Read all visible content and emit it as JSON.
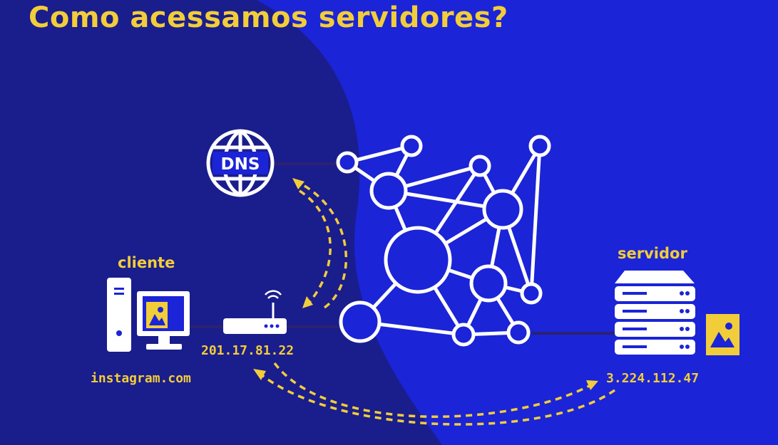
{
  "title": "Como acessamos servidores?",
  "labels": {
    "client": "cliente",
    "server": "servidor",
    "dns": "DNS",
    "router_ip": "201.17.81.22",
    "client_domain": "instagram.com",
    "server_ip": "3.224.112.47"
  },
  "colors": {
    "background": "#1b24d6",
    "background_dark": "#1a1d8c",
    "accent": "#f2cd3a",
    "line": "#ffffff",
    "link": "#2b2270"
  },
  "icons": [
    "dns-globe-icon",
    "desktop-computer-icon",
    "image-icon",
    "wifi-router-icon",
    "server-rack-icon",
    "network-graph-icon"
  ]
}
